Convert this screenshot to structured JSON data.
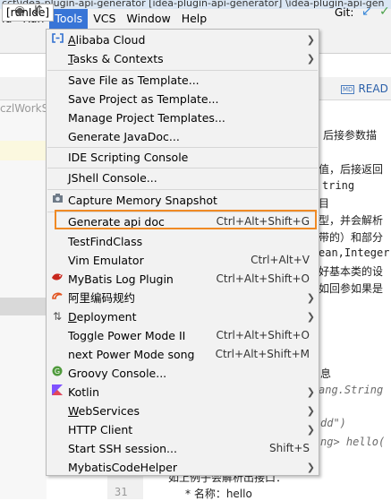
{
  "window": {
    "title_fragment": "cct\\idea-plugin-api-generator [idea-plugin-api-generator] \\idea-plugin-api-gen"
  },
  "menubar": [
    "ld",
    "Run",
    "Tools",
    "VCS",
    "Window",
    "Help"
  ],
  "toolbar": {
    "run_config": "[runIde]",
    "git_label": "Git:"
  },
  "left_panel": {
    "project_label": "czlWorkS"
  },
  "editor_tab": {
    "badge": "MD",
    "label": "READ"
  },
  "editor": {
    "lines": [
      "后接参数描",
      "值，后接返回",
      "tring",
      "目",
      "型，并会解析",
      "带的）和部分",
      "ean,Integer",
      "好基本类的设",
      "如回参如果是",
      "息",
      "ang.String",
      "dd\")",
      "ng> hello(",
      "如上例子会解析出接口：",
      "* 名称：hello"
    ],
    "line_number": "31"
  },
  "menu": {
    "items": [
      {
        "label": "Alibaba Cloud",
        "mn": "A",
        "rest": "libaba Cloud",
        "shortcut": "",
        "submenu": true,
        "icon": "alibaba-cloud-icon"
      },
      {
        "label": "Tasks & Contexts",
        "mn": "T",
        "rest": "asks & Contexts",
        "shortcut": "",
        "submenu": true,
        "icon": ""
      },
      {
        "label": "Save File as Template...",
        "shortcut": "",
        "submenu": false,
        "icon": ""
      },
      {
        "label": "Save Project as Template...",
        "shortcut": "",
        "submenu": false,
        "icon": ""
      },
      {
        "label": "Manage Project Templates...",
        "shortcut": "",
        "submenu": false,
        "icon": ""
      },
      {
        "label": "Generate JavaDoc...",
        "shortcut": "",
        "submenu": false,
        "icon": ""
      },
      {
        "label": "IDE Scripting Console",
        "shortcut": "",
        "submenu": false,
        "icon": ""
      },
      {
        "label": "JShell Console...",
        "shortcut": "",
        "submenu": false,
        "icon": ""
      },
      {
        "label": "Capture Memory Snapshot",
        "shortcut": "",
        "submenu": false,
        "icon": "memory-snapshot-icon"
      },
      {
        "label": "Generate api doc",
        "shortcut": "Ctrl+Alt+Shift+G",
        "submenu": false,
        "icon": ""
      },
      {
        "label": "TestFindClass",
        "shortcut": "",
        "submenu": false,
        "icon": ""
      },
      {
        "label": "Vim Emulator",
        "shortcut": "Ctrl+Alt+V",
        "submenu": false,
        "icon": ""
      },
      {
        "label": "MyBatis Log Plugin",
        "shortcut": "Ctrl+Alt+Shift+O",
        "submenu": false,
        "icon": "mybatis-bird-icon"
      },
      {
        "label": "阿里编码规约",
        "shortcut": "",
        "submenu": true,
        "icon": "alibaba-coding-icon"
      },
      {
        "label": "Deployment",
        "mn": "D",
        "rest": "eployment",
        "shortcut": "",
        "submenu": true,
        "icon": "deployment-icon"
      },
      {
        "label": "Toggle Power Mode II",
        "shortcut": "Ctrl+Alt+Shift+O",
        "submenu": false,
        "icon": ""
      },
      {
        "label": "next Power Mode song",
        "shortcut": "Ctrl+Alt+Shift+M",
        "submenu": false,
        "icon": ""
      },
      {
        "label": "Groovy Console...",
        "shortcut": "",
        "submenu": false,
        "icon": "groovy-icon"
      },
      {
        "label": "Kotlin",
        "shortcut": "",
        "submenu": true,
        "icon": "kotlin-icon"
      },
      {
        "label": "WebServices",
        "mn": "W",
        "rest": "ebServices",
        "shortcut": "",
        "submenu": true,
        "icon": ""
      },
      {
        "label": "HTTP Client",
        "shortcut": "",
        "submenu": true,
        "icon": ""
      },
      {
        "label": "Start SSH session...",
        "shortcut": "Shift+S",
        "submenu": false,
        "icon": ""
      },
      {
        "label": "MybatisCodeHelper",
        "shortcut": "",
        "submenu": true,
        "icon": ""
      }
    ]
  },
  "colors": {
    "menu_active": "#3875d7",
    "highlight_border": "#f08a24",
    "menu_bg": "#f2f2f2"
  }
}
